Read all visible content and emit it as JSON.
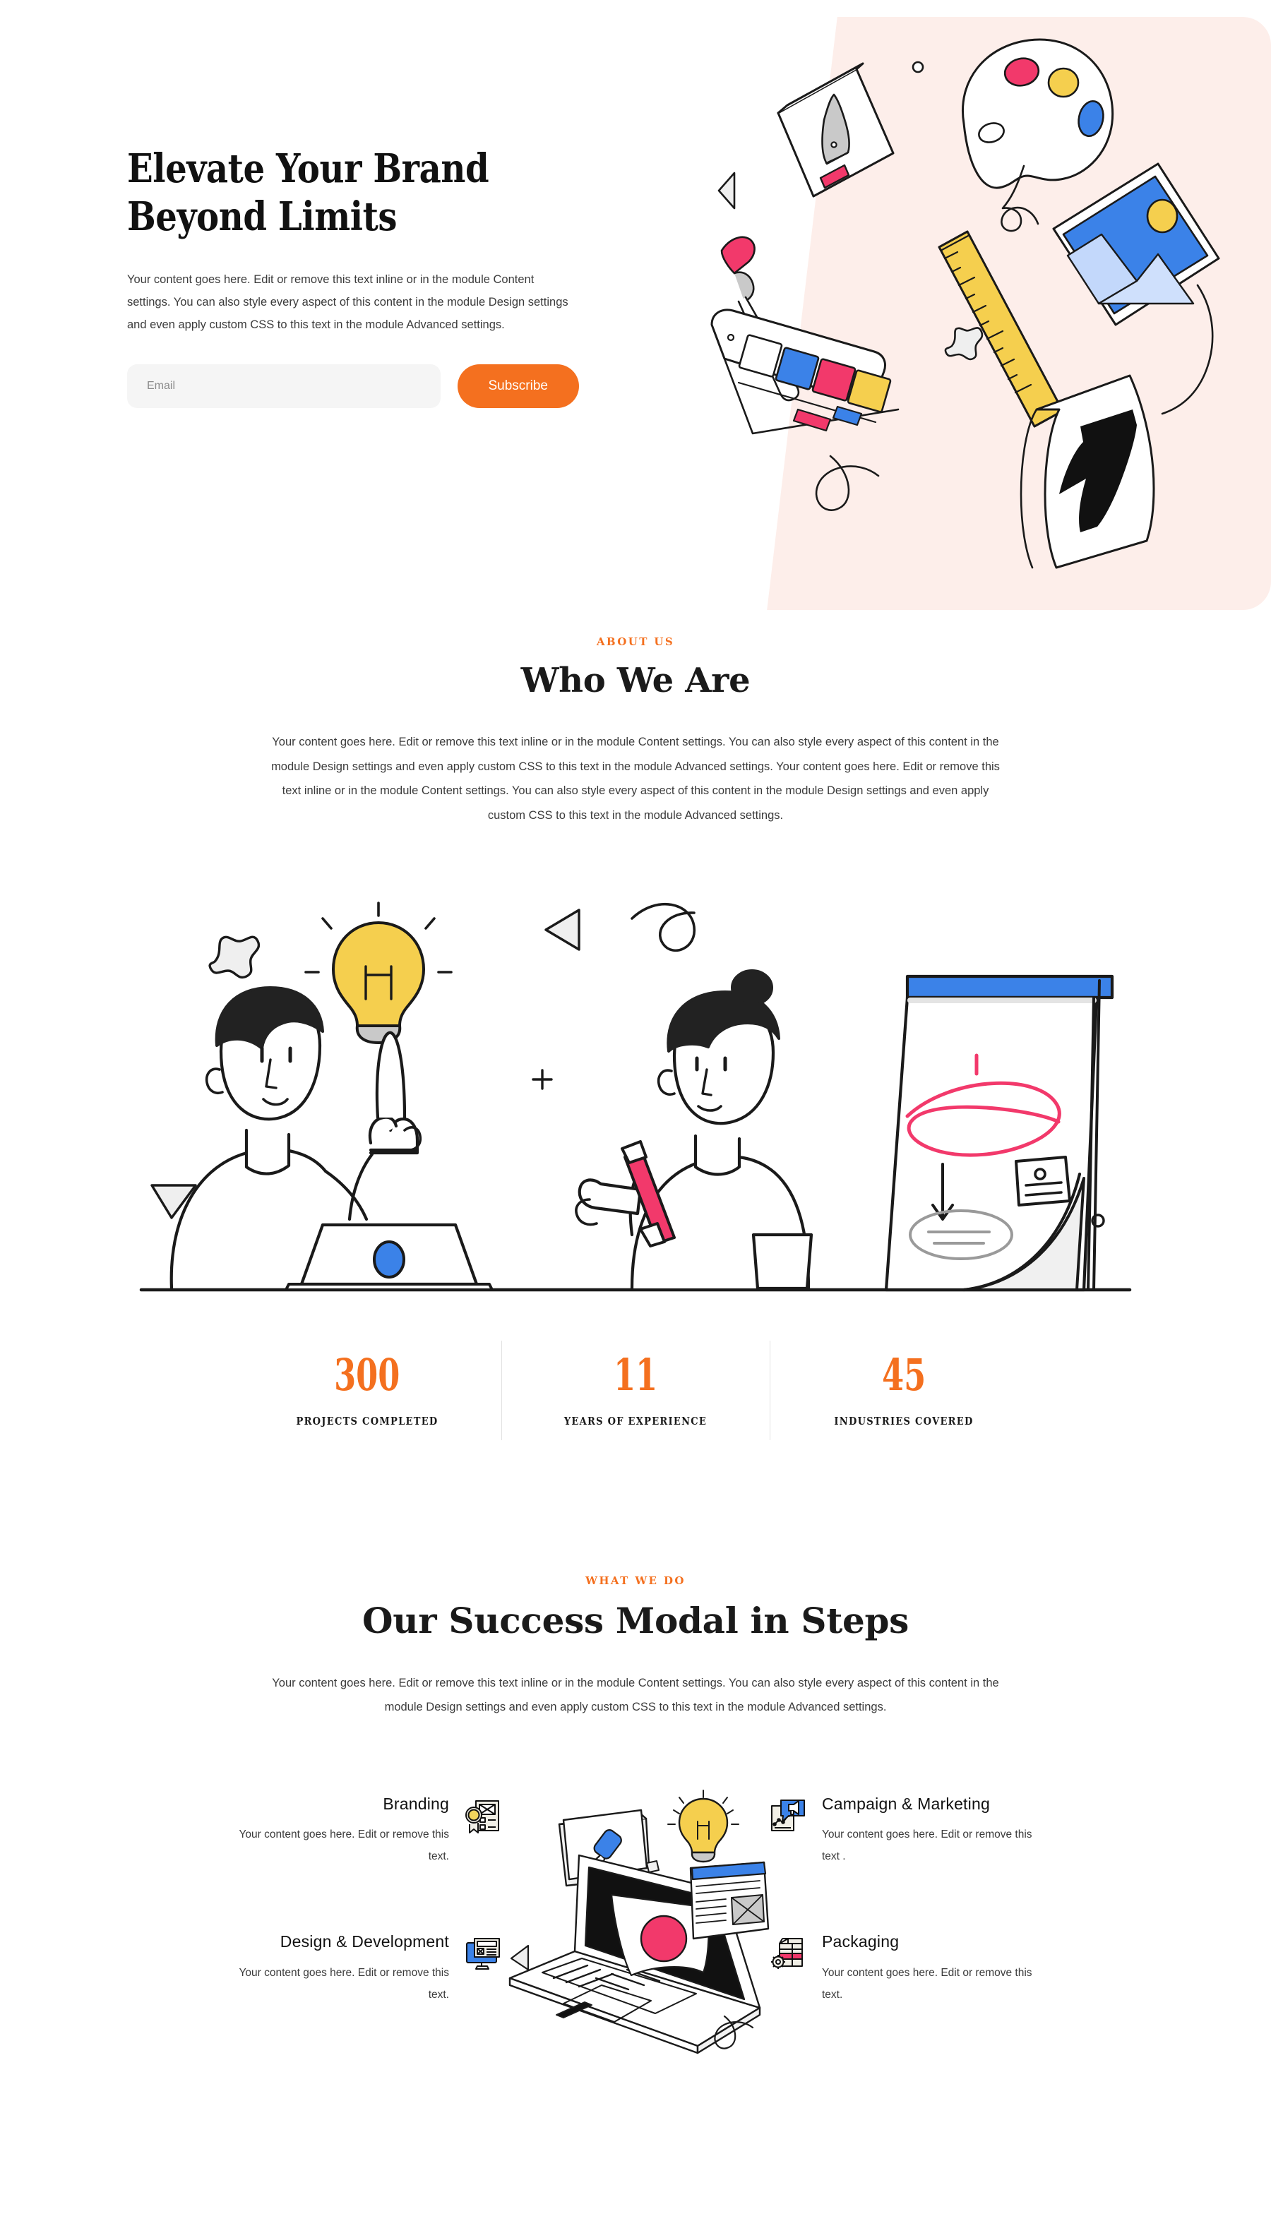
{
  "colors": {
    "accent_orange": "#f4701f",
    "blush_bg": "#fdeeea",
    "input_bg": "#f5f5f5",
    "text_dark": "#111111",
    "text_body": "#3b3b3b",
    "divider": "#e2e2e2",
    "illus_yellow": "#f5cf4e",
    "illus_pink": "#f2396b",
    "illus_blue": "#3b82e8"
  },
  "hero": {
    "title": "Elevate Your Brand\nBeyond Limits",
    "body": "Your content goes here. Edit or remove this text inline or in the module Content settings. You can also style every aspect of this content in the module Design settings and even apply custom CSS to this text in the module Advanced settings.",
    "email_placeholder": "Email",
    "email_value": "",
    "subscribe_label": "Subscribe",
    "illustration_name": "design-tools-illustration"
  },
  "about": {
    "eyebrow": "ABOUT US",
    "title": "Who We Are",
    "body": "Your content goes here. Edit or remove this text inline or in the module Content settings. You can also style every aspect of this content in the module Design settings and even apply custom CSS to this text in the module Advanced settings. Your content goes here. Edit or remove this text inline or in the module Content settings. You can also style every aspect of this content in the module Design settings and even apply custom CSS to this text in the module Advanced settings.",
    "illustration_name": "team-brainstorm-illustration",
    "stats": [
      {
        "number": "300",
        "label": "PROJECTS COMPLETED"
      },
      {
        "number": "11",
        "label": "YEARS OF EXPERIENCE"
      },
      {
        "number": "45",
        "label": "INDUSTRIES COVERED"
      }
    ]
  },
  "steps": {
    "eyebrow": "WHAT WE DO",
    "title": "Our Success Modal in Steps",
    "body": "Your content goes here. Edit or remove this text inline or in the module Content settings. You can also style every aspect of this content in the module Design settings and even apply custom CSS to this text in the module Advanced settings.",
    "illustration_name": "laptop-creative-illustration",
    "left_services": [
      {
        "title": "Branding",
        "desc": "Your content goes here. Edit or remove this text.",
        "icon": "certificate-badge-icon"
      },
      {
        "title": "Design & Development",
        "desc": "Your content goes here. Edit or remove this text.",
        "icon": "monitor-layout-icon"
      }
    ],
    "right_services": [
      {
        "title": "Campaign & Marketing",
        "desc": "Your content goes here. Edit or remove this text .",
        "icon": "megaphone-chart-icon"
      },
      {
        "title": "Packaging",
        "desc": "Your content goes here. Edit or remove this text.",
        "icon": "box-gear-icon"
      }
    ]
  }
}
